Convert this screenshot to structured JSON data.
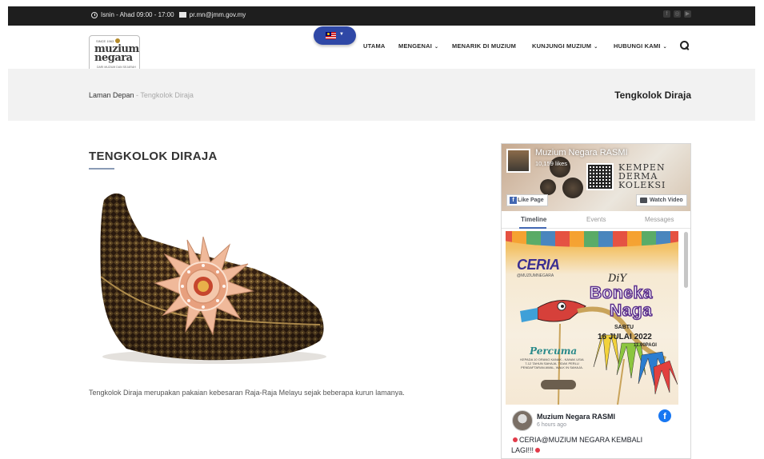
{
  "topbar": {
    "hours": "Isnin - Ahad 09:00 - 17:00",
    "email": "pr.mn@jmm.gov.my",
    "social_icons": [
      "facebook-icon",
      "instagram-icon",
      "youtube-icon"
    ]
  },
  "logo": {
    "since": "SINCE 1963",
    "word1": "muzium",
    "word2": "negara",
    "sub": "DARI MUZIUM DAN SEJARAH"
  },
  "language": {
    "flag": "malaysia-flag-icon"
  },
  "nav": {
    "items": [
      {
        "label": "UTAMA",
        "has_dropdown": false
      },
      {
        "label": "MENGENAI",
        "has_dropdown": true
      },
      {
        "label": "MENARIK DI MUZIUM",
        "has_dropdown": false
      },
      {
        "label": "KUNJUNGI MUZIUM",
        "has_dropdown": true
      },
      {
        "label": "HUBUNGI KAMI",
        "has_dropdown": true
      }
    ],
    "chevron": "⌄"
  },
  "breadcrumb": {
    "home": "Laman Depan",
    "separator": " - ",
    "current": "Tengkolok Diraja",
    "page_title": "Tengkolok Diraja"
  },
  "article": {
    "title": "TENGKOLOK DIRAJA",
    "description": "Tengkolok Diraja merupakan pakaian kebesaran Raja-Raja Melayu sejak beberapa kurun lamanya."
  },
  "facebook": {
    "page_name": "Muzium Negara RASMI",
    "likes": "10,159 likes",
    "cover_text": [
      "KEMPEN",
      "DERMA",
      "KOLEKSI"
    ],
    "like_button": "Like Page",
    "watch_button": "Watch Video",
    "tabs": [
      "Timeline",
      "Events",
      "Messages"
    ],
    "poster": {
      "brand": "CERIA",
      "brand_sub": "@MUZIUMNEGARA",
      "diy": "DiY",
      "title1": "Boneka",
      "title2": "Naga",
      "day": "SABTU",
      "date": "16 JULAI 2022",
      "time": "11.00PAGI",
      "free": "Percuma",
      "details": "KEPADA 10 ORANG KANAK - KANAK USIA 7-12 TAHUN SAHAJA. TIDAK PERLU PENDAFTARAN AWAL, WALK IN SAHAJA."
    },
    "post": {
      "author": "Muzium Negara RASMI",
      "time": "6 hours ago",
      "text": "CERIA@MUZIUM NEGARA KEMBALI LAGI!!!"
    }
  },
  "colors": {
    "topbar_bg": "#1e1e1e",
    "lang_button": "#2f48a6",
    "band_bg": "#f2f2f2",
    "facebook_blue": "#1877f2"
  }
}
